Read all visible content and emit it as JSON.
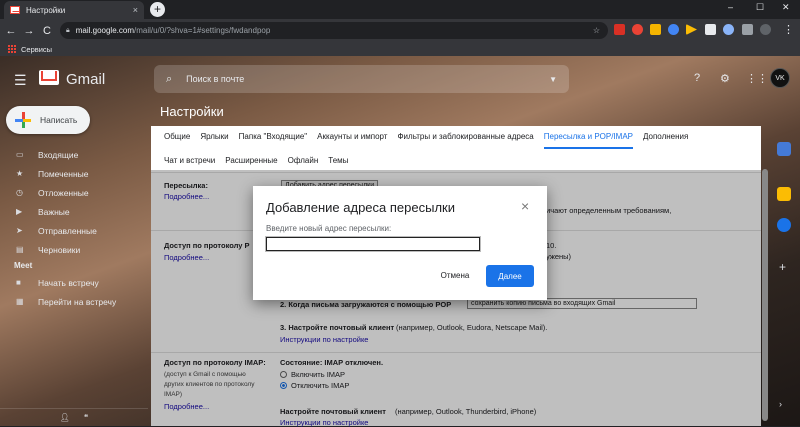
{
  "browser": {
    "tab_title": "Настройки",
    "tab_close": "×",
    "new_tab": "+",
    "window_controls": [
      "–",
      "☐",
      "✕"
    ],
    "url_host": "mail.google.com",
    "url_path": "/mail/u/0/?shva=1#settings/fwdandpop",
    "bookmark": "Сервисы",
    "nav": {
      "back": "←",
      "forward": "→",
      "reload": "C"
    }
  },
  "gmail": {
    "brand": "Gmail",
    "search_placeholder": "Поиск в почте",
    "avatar_text": "VK",
    "compose_label": "Написать",
    "settings_title": "Настройки",
    "sidebar": [
      {
        "label": "Входящие",
        "icon": "inbox-icon",
        "glyph": "▭"
      },
      {
        "label": "Помеченные",
        "icon": "star-icon",
        "glyph": "★"
      },
      {
        "label": "Отложенные",
        "icon": "clock-icon",
        "glyph": "◷"
      },
      {
        "label": "Важные",
        "icon": "important-icon",
        "glyph": "▶"
      },
      {
        "label": "Отправленные",
        "icon": "send-icon",
        "glyph": "➤"
      },
      {
        "label": "Черновики",
        "icon": "draft-icon",
        "glyph": "▤"
      }
    ],
    "meet_heading": "Meet",
    "meet_items": [
      {
        "label": "Начать встречу",
        "icon": "video-icon",
        "glyph": "■"
      },
      {
        "label": "Перейти на встречу",
        "icon": "keyboard-icon",
        "glyph": "▦"
      }
    ]
  },
  "settings": {
    "tabs_row1": [
      "Общие",
      "Ярлыки",
      "Папка \"Входящие\"",
      "Аккаунты и импорт",
      "Фильтры и заблокированные адреса",
      "Пересылка и POP/IMAP",
      "Дополнения"
    ],
    "active_tab": "Пересылка и POP/IMAP",
    "tabs_row2": [
      "Чат и встречи",
      "Расширенные",
      "Офлайн",
      "Темы"
    ],
    "forwarding": {
      "label": "Пересылка:",
      "more": "Подробнее...",
      "add_button": "Добавить адрес пересылки",
      "partial_text": "ичают определенным требованиям,"
    },
    "pop": {
      "label": "Доступ по протоколу Р",
      "more": "Подробнее...",
      "partial1": "10.",
      "partial2": "ужены)",
      "step2_label": "2. Когда письма загружаются с помощью POP",
      "step2_value": "сохранить копию письма во входящих Gmail",
      "step3_label": "3. Настройте почтовый клиент",
      "step3_rest": "(например, Outlook, Eudora, Netscape Mail).",
      "instructions": "Инструкции по настройке"
    },
    "imap": {
      "label": "Доступ по протоколу IMAP:",
      "desc": [
        "(доступ к Gmail с помощью",
        "других клиентов по протоколу",
        "IMAP)"
      ],
      "more": "Подробнее...",
      "status_label": "Состояние: IMAP отключен.",
      "enable": "Включить IMAP",
      "disable": "Отключить IMAP",
      "client_label": "Настройте почтовый клиент",
      "client_rest": "(например, Outlook, Thunderbird, iPhone)",
      "instructions": "Инструкции по настройке"
    }
  },
  "dialog": {
    "title": "Добавление адреса пересылки",
    "prompt": "Введите новый адрес пересылки:",
    "input_value": "",
    "cancel": "Отмена",
    "next": "Далее",
    "close": "×"
  },
  "colors": {
    "accent": "#1a73e8",
    "gmail_red": "#ea4335"
  }
}
